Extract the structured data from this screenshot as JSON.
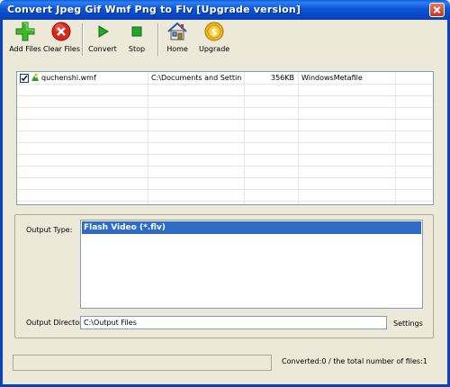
{
  "window": {
    "title": "Convert Jpeg Gif Wmf Png to Flv [Upgrade version]"
  },
  "toolbar": {
    "buttons": [
      {
        "label": "Add Files",
        "icon": "plus-icon"
      },
      {
        "label": "Clear Files",
        "icon": "close-icon"
      },
      {
        "label": "Convert",
        "icon": "play-icon"
      },
      {
        "label": "Stop",
        "icon": "stop-icon"
      },
      {
        "label": "Home",
        "icon": "home-icon"
      },
      {
        "label": "Upgrade",
        "icon": "dollar-coin-icon"
      }
    ]
  },
  "files": [
    {
      "checked": true,
      "name": "quchenshi.wmf",
      "path": "C:\\Documents and Setting...",
      "size": "356KB",
      "type": "WindowsMetafile"
    }
  ],
  "output": {
    "type_label": "Output Type:",
    "types": [
      "Flash Video (*.flv)"
    ],
    "selected_type": "Flash Video (*.flv)",
    "dir_label": "Output Directory:",
    "dir_value": "C:\\Output Files",
    "settings_label": "Settings"
  },
  "status": {
    "text": "Converted:0  /  the total number of files:1"
  },
  "colors": {
    "titlebar": "#0a4fd0",
    "selection": "#316ac5",
    "panel": "#ece9d8"
  }
}
